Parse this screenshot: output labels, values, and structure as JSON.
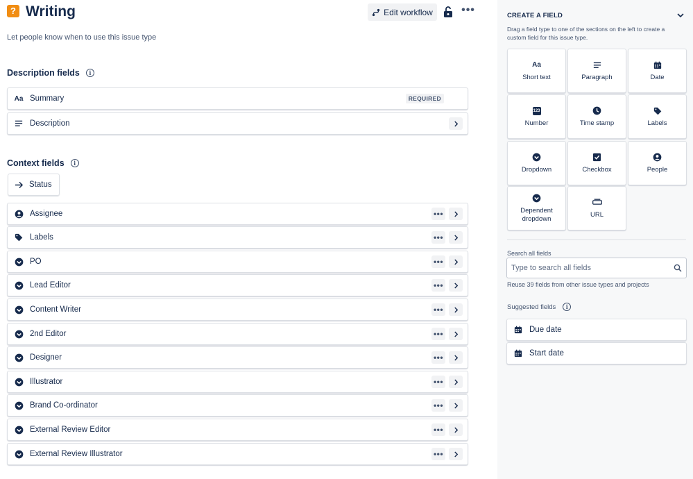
{
  "header": {
    "type_icon_glyph": "?",
    "title": "Writing",
    "edit_workflow_label": "Edit workflow",
    "more_label": "•••",
    "subtitle": "Let people know when to use this issue type"
  },
  "description_section": {
    "title": "Description fields",
    "info_glyph": "i",
    "fields": [
      {
        "label": "Summary",
        "icon": "text-aa-icon",
        "badge": "REQUIRED"
      },
      {
        "label": "Description",
        "icon": "paragraph-icon"
      }
    ]
  },
  "context_section": {
    "title": "Context fields",
    "info_glyph": "i",
    "status_label": "Status",
    "dots_label": "•••",
    "fields": [
      {
        "label": "Assignee",
        "icon": "person-icon"
      },
      {
        "label": "Labels",
        "icon": "tag-icon"
      },
      {
        "label": "PO",
        "icon": "dropdown-icon"
      },
      {
        "label": "Lead Editor",
        "icon": "dropdown-icon"
      },
      {
        "label": "Content Writer",
        "icon": "dropdown-icon"
      },
      {
        "label": "2nd Editor",
        "icon": "dropdown-icon"
      },
      {
        "label": "Designer",
        "icon": "dropdown-icon"
      },
      {
        "label": "Illustrator",
        "icon": "dropdown-icon"
      },
      {
        "label": "Brand Co-ordinator",
        "icon": "dropdown-icon"
      },
      {
        "label": "External Review Editor",
        "icon": "dropdown-icon"
      },
      {
        "label": "External Review Illustrator",
        "icon": "dropdown-icon"
      }
    ]
  },
  "create_field": {
    "title": "CREATE A FIELD",
    "description": "Drag a field type to one of the sections on the left to create a custom field for this issue type.",
    "tiles": [
      {
        "label": "Short text",
        "icon": "text-aa-icon",
        "glyph": "Aa"
      },
      {
        "label": "Paragraph",
        "icon": "paragraph-icon"
      },
      {
        "label": "Date",
        "icon": "calendar-icon"
      },
      {
        "label": "Number",
        "icon": "number-icon",
        "glyph": "123"
      },
      {
        "label": "Time stamp",
        "icon": "clock-icon"
      },
      {
        "label": "Labels",
        "icon": "tag-icon"
      },
      {
        "label": "Dropdown",
        "icon": "dropdown-icon"
      },
      {
        "label": "Checkbox",
        "icon": "checkbox-icon"
      },
      {
        "label": "People",
        "icon": "person-icon"
      },
      {
        "label": "Dependent dropdown",
        "icon": "dropdown-icon"
      },
      {
        "label": "URL",
        "icon": "link-icon"
      }
    ],
    "search_label": "Search all fields",
    "search_placeholder": "Type to search all fields",
    "reuse_text": "Reuse 39 fields from other issue types and projects",
    "suggested_title": "Suggested fields",
    "suggested_info_glyph": "i",
    "suggested": [
      {
        "label": "Due date",
        "icon": "calendar-icon"
      },
      {
        "label": "Start date",
        "icon": "calendar-icon"
      }
    ]
  },
  "colors": {
    "text": "#172b4d",
    "subtle": "#44546f",
    "border": "#dcdfe4",
    "panel_bg": "#f7f8f9",
    "type_icon_bg": "#f18d13"
  }
}
